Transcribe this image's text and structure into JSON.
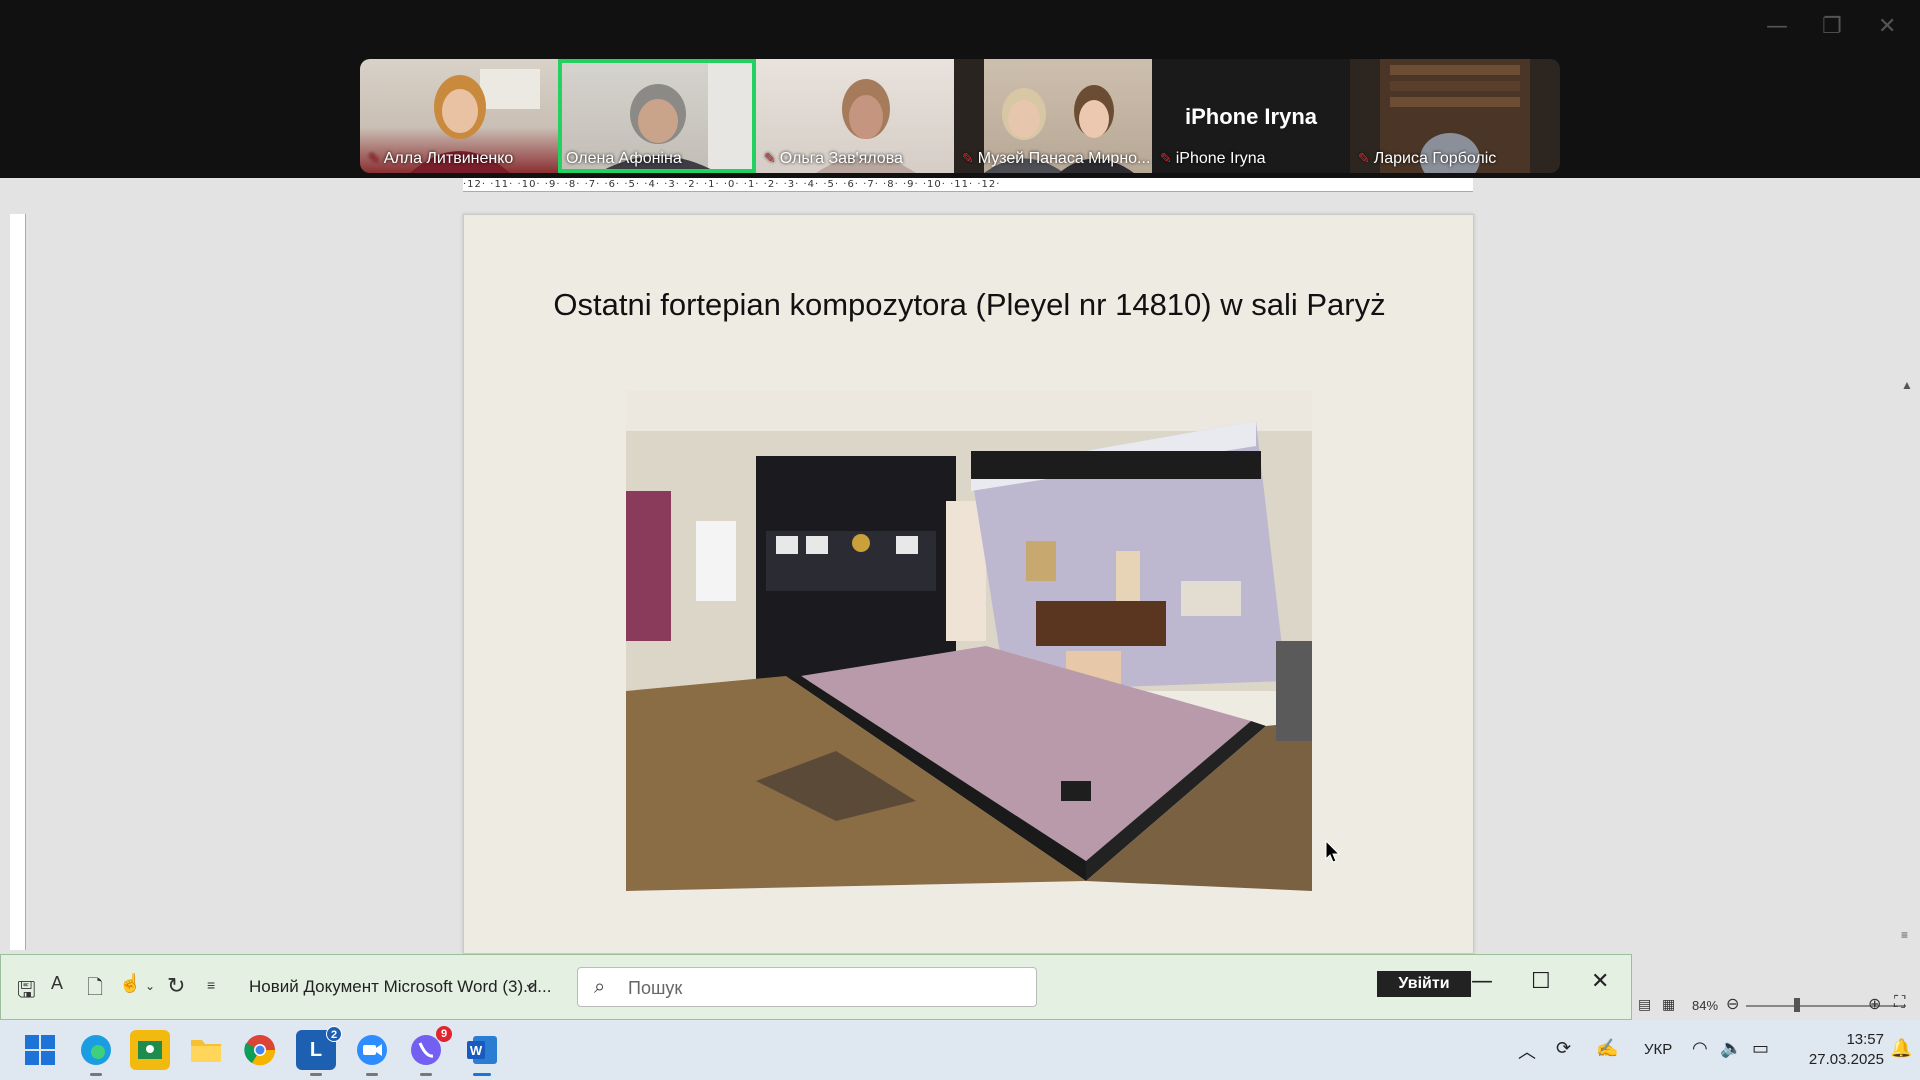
{
  "zoom": {
    "participants": [
      {
        "name": "Алла Литвиненко",
        "muted": true,
        "active": false
      },
      {
        "name": "Олена Афоніна",
        "muted": false,
        "active": true
      },
      {
        "name": "Ольга Зав'ялова",
        "muted": true,
        "active": false
      },
      {
        "name": "Музей Панаса Мирно...",
        "muted": true,
        "active": false
      },
      {
        "name": "iPhone Iryna",
        "muted": true,
        "active": false,
        "avatar_text": "iPhone Iryna"
      },
      {
        "name": "Лариса Горболіс",
        "muted": true,
        "active": false
      }
    ],
    "active_color": "#23d160"
  },
  "ruler": {
    "top_ticks": "·12·  ·11·  ·10·  ·9·  ·8·  ·7·  ·6·  ·5·  ·4·  ·3·  ·2·  ·1·  ·0·  ·1·  ·2·  ·3·  ·4·  ·5·  ·6·  ·7·  ·8·  ·9·  ·10·  ·11·  ·12·"
  },
  "document": {
    "slide_title": "Ostatni fortepian kompozytora (Pleyel nr 14810) w sali Paryż"
  },
  "word_titlebar": {
    "doc_title": "Новий Документ Microsoft Word (3).d...",
    "search_placeholder": "Пошук",
    "signin_label": "Увійти"
  },
  "statusbar": {
    "zoom_level": "84%"
  },
  "taskbar": {
    "apps": [
      {
        "name": "start",
        "icon": "windows-icon"
      },
      {
        "name": "edge",
        "icon": "edge-icon"
      },
      {
        "name": "classroom",
        "icon": "classroom-icon"
      },
      {
        "name": "explorer",
        "icon": "folder-icon"
      },
      {
        "name": "chrome",
        "icon": "chrome-icon"
      },
      {
        "name": "lingva",
        "icon": "l-icon",
        "badge": "2"
      },
      {
        "name": "zoom",
        "icon": "zoom-icon"
      },
      {
        "name": "viber",
        "icon": "viber-icon",
        "badge": "9"
      },
      {
        "name": "word",
        "icon": "word-icon"
      }
    ],
    "language": "УКР",
    "time": "13:57",
    "date": "27.03.2025"
  }
}
